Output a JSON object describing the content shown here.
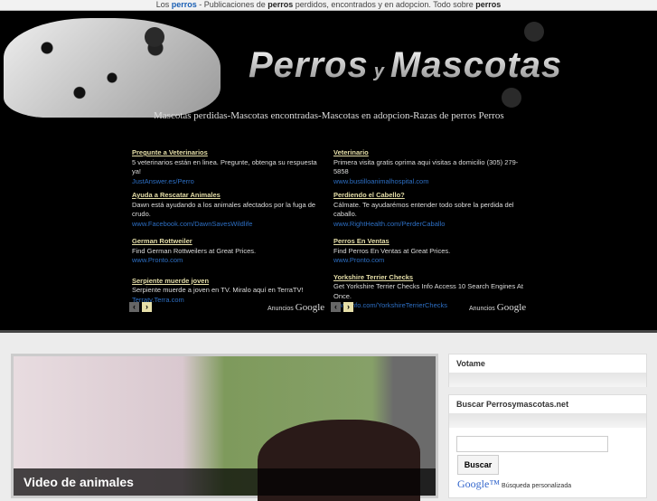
{
  "topbar": {
    "t1": "Los ",
    "l1": "perros",
    "t2": " - Publicaciones de ",
    "b1": "perros",
    "t3": " perdidos, encontrados y en adopcion. Todo sobre ",
    "b2": "perros"
  },
  "banner": {
    "title1": "Perros",
    "title_y": "y",
    "title2": "Mascotas",
    "tagline": "Mascotas perdidas-Mascotas encontradas-Mascotas en adopcion-Razas de perros Perros"
  },
  "ads_left": [
    {
      "title": "Pregunte a Veterinarios",
      "desc": "5 veterinarios están en linea. Pregunte, obtenga su respuesta ya!",
      "url": "JustAnswer.es/Perro"
    },
    {
      "title": "Ayuda a Rescatar Animales",
      "desc": "Dawn está ayudando a los animales afectados por la fuga de crudo.",
      "url": "www.Facebook.com/DawnSavesWildlife"
    },
    {
      "title": "German Rottweiler",
      "desc": "Find German Rottweilers at Great Prices.",
      "url": "www.Pronto.com"
    },
    {
      "title": "Serpiente muerde joven",
      "desc": "Serpiente muerde a joven en TV. Miralo aquí en TerraTV!",
      "url": "Terratv.Terra.com"
    }
  ],
  "ads_right": [
    {
      "title": "Veterinario",
      "desc": "Primera visita gratis oprima aqui visitas a domicilio (305) 279-5858",
      "url": "www.bustilloanimalhospital.com"
    },
    {
      "title": "Perdiendo el Cabello?",
      "desc": "Cálmate. Te ayudarémos entender todo sobre la perdida del caballo.",
      "url": "www.RightHealth.com/PerderCaballo"
    },
    {
      "title": "Perros En Ventas",
      "desc": "Find Perros En Ventas at Great Prices.",
      "url": "www.Pronto.com"
    },
    {
      "title": "Yorkshire Terrier Checks",
      "desc": "Get Yorkshire Terrier Checks Info Access 10 Search Engines At Once.",
      "url": "www.Info.com/YorkshireTerrierChecks"
    }
  ],
  "ads_footer": {
    "prev": "‹",
    "next": "›",
    "label": "Anuncios",
    "brand": "Google"
  },
  "video": {
    "caption": "Video de animales"
  },
  "sidebar": {
    "votame": "Votame",
    "search_title": "Buscar Perrosymascotas.net",
    "search_value": "",
    "search_button": "Buscar",
    "google": "Google™",
    "custom": "Búsqueda personalizada"
  }
}
